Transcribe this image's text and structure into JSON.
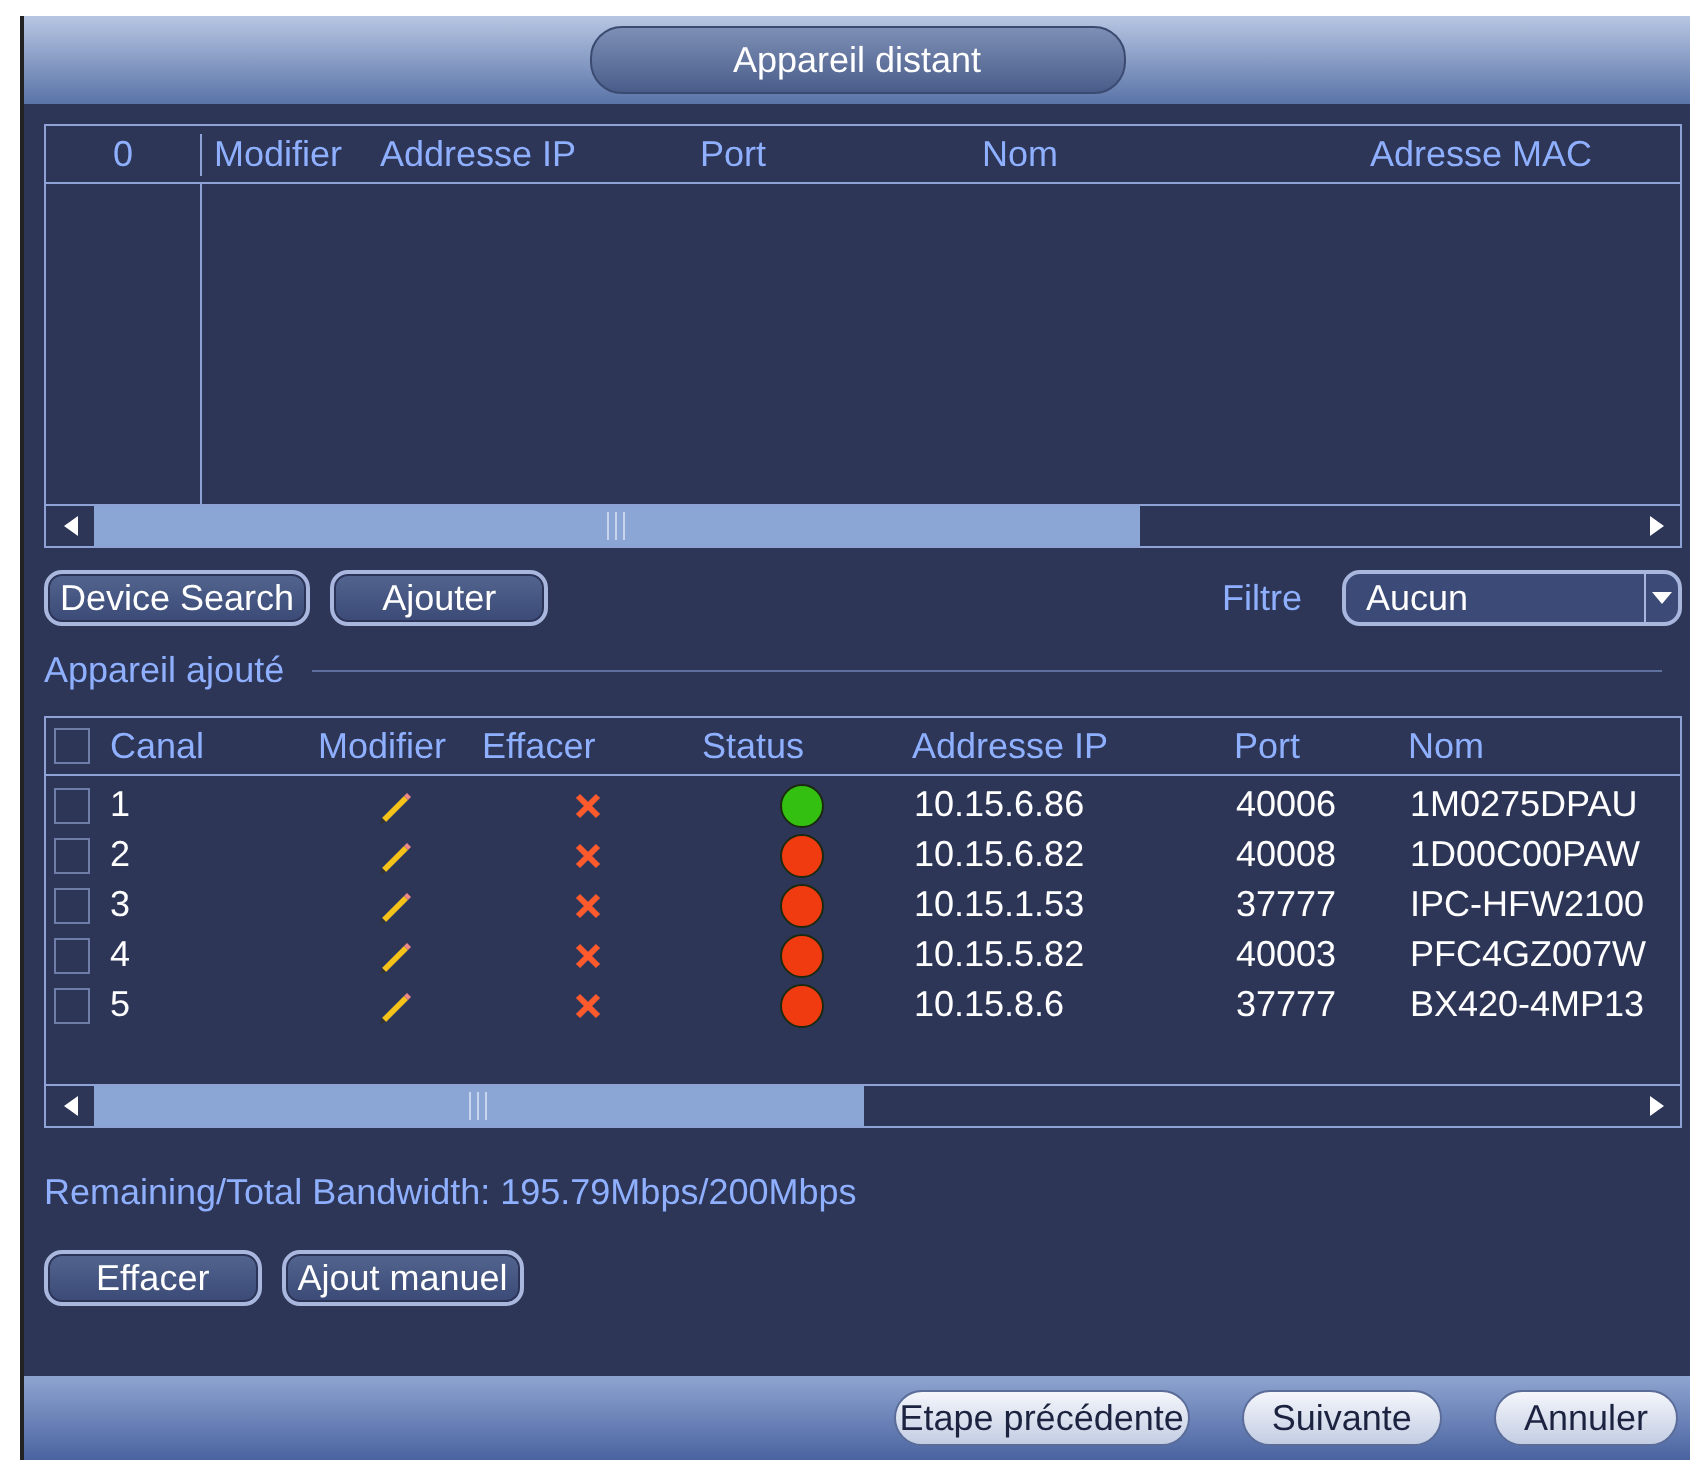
{
  "window": {
    "title": "Appareil distant"
  },
  "search_table": {
    "columns": [
      "0",
      "Modifier",
      "Addresse IP",
      "Port",
      "Nom",
      "Adresse MAC"
    ]
  },
  "actions": [
    {
      "label": "Device Search"
    },
    {
      "label": "Ajouter"
    }
  ],
  "filter": {
    "label": "Filtre",
    "value": "Aucun"
  },
  "added_section": {
    "title": "Appareil ajouté"
  },
  "added_table": {
    "select_all_checked": false,
    "columns": [
      "Canal",
      "Modifier",
      "Effacer",
      "Status",
      "Addresse IP",
      "Port",
      "Nom"
    ],
    "rows": [
      {
        "checked": false,
        "canal": "1",
        "color": "#33c010",
        "ip": "10.15.6.86",
        "port": "40006",
        "nom": "1M0275DPAU"
      },
      {
        "checked": false,
        "canal": "2",
        "color": "#f03a10",
        "ip": "10.15.6.82",
        "port": "40008",
        "nom": "1D00C00PAW"
      },
      {
        "checked": false,
        "canal": "3",
        "color": "#f03a10",
        "ip": "10.15.1.53",
        "port": "37777",
        "nom": "IPC-HFW2100"
      },
      {
        "checked": false,
        "canal": "4",
        "color": "#f03a10",
        "ip": "10.15.5.82",
        "port": "40003",
        "nom": "PFC4GZ007W"
      },
      {
        "checked": false,
        "canal": "5",
        "color": "#f03a10",
        "ip": "10.15.8.6",
        "port": "37777",
        "nom": "BX420-4MP13"
      }
    ]
  },
  "bandwidth": "Remaining/Total Bandwidth: 195.79Mbps/200Mbps",
  "bottom_actions": [
    {
      "label": "Effacer"
    },
    {
      "label": "Ajout manuel"
    }
  ],
  "footer_buttons": [
    {
      "label": "Etape précédente"
    },
    {
      "label": "Suivante"
    },
    {
      "label": "Annuler"
    }
  ]
}
